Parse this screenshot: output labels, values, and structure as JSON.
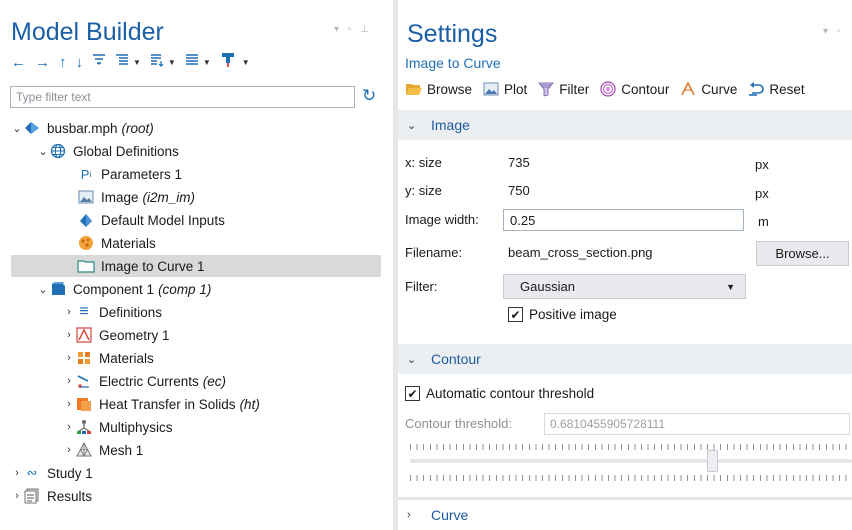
{
  "model_builder": {
    "title": "Model Builder",
    "filter_placeholder": "Type filter text",
    "tree": [
      {
        "label": "busbar.mph",
        "tag": "(root)"
      },
      {
        "label": "Global Definitions",
        "tag": ""
      },
      {
        "label": "Parameters 1",
        "tag": ""
      },
      {
        "label": "Image",
        "tag": "(i2m_im)"
      },
      {
        "label": "Default Model Inputs",
        "tag": ""
      },
      {
        "label": "Materials",
        "tag": ""
      },
      {
        "label": "Image to Curve 1",
        "tag": ""
      },
      {
        "label": "Component 1",
        "tag": "(comp 1)"
      },
      {
        "label": "Definitions",
        "tag": ""
      },
      {
        "label": "Geometry 1",
        "tag": ""
      },
      {
        "label": "Materials",
        "tag": ""
      },
      {
        "label": "Electric Currents",
        "tag": "(ec)"
      },
      {
        "label": "Heat Transfer in Solids",
        "tag": "(ht)"
      },
      {
        "label": "Multiphysics",
        "tag": ""
      },
      {
        "label": "Mesh 1",
        "tag": ""
      },
      {
        "label": "Study 1",
        "tag": ""
      },
      {
        "label": "Results",
        "tag": ""
      }
    ]
  },
  "settings": {
    "title": "Settings",
    "subtitle": "Image to Curve",
    "toolbar": [
      "Browse",
      "Plot",
      "Filter",
      "Contour",
      "Curve",
      "Reset"
    ],
    "image_section": {
      "title": "Image",
      "x_size_label": "x: size",
      "x_size_value": "735",
      "x_size_unit": "px",
      "y_size_label": "y: size",
      "y_size_value": "750",
      "y_size_unit": "px",
      "width_label": "Image width:",
      "width_value": "0.25",
      "width_unit": "m",
      "filename_label": "Filename:",
      "filename_value": "beam_cross_section.png",
      "browse_button": "Browse...",
      "filter_label": "Filter:",
      "filter_value": "Gaussian",
      "positive_image_label": "Positive image",
      "positive_image_checked": true
    },
    "contour_section": {
      "title": "Contour",
      "auto_threshold_label": "Automatic contour threshold",
      "auto_threshold_checked": true,
      "threshold_label": "Contour threshold:",
      "threshold_value": "0.6810455905728111"
    },
    "curve_section": {
      "title": "Curve"
    }
  },
  "colors": {
    "accent": "#1b5fa8",
    "selection": "#d9d9d9",
    "section_bar": "#eceff2"
  }
}
